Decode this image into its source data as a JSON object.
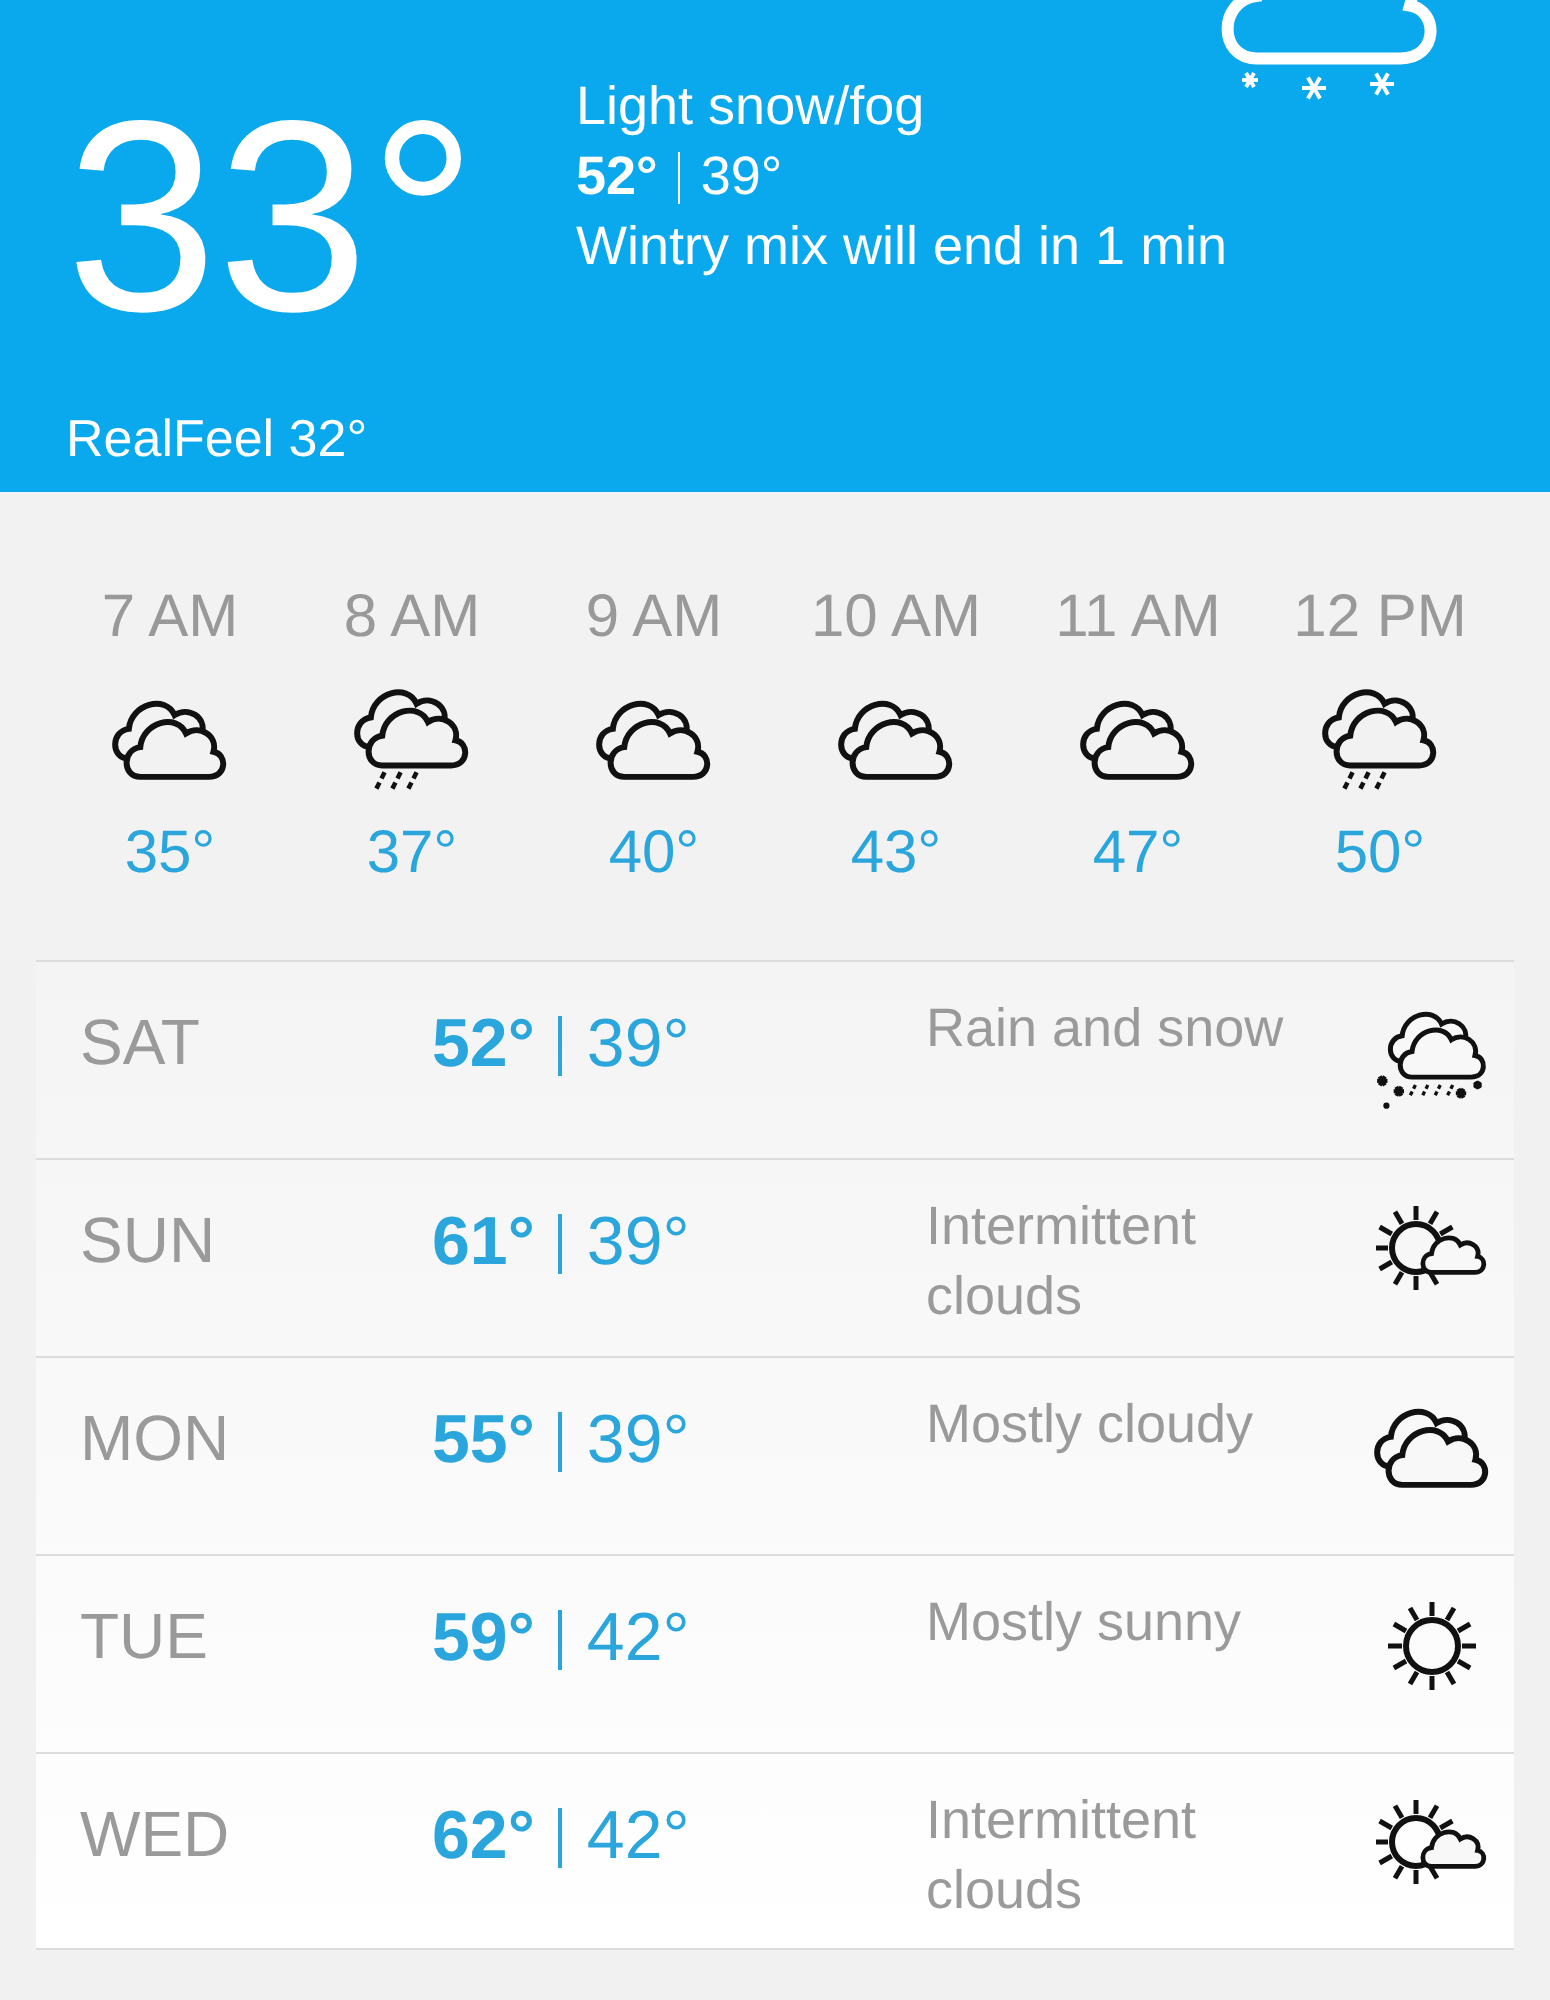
{
  "current": {
    "temperature": "33°",
    "condition": "Light snow/fog",
    "high": "52°",
    "low": "39°",
    "note": "Wintry mix will end in 1 min",
    "realfeel": "RealFeel 32°",
    "kind": "snow"
  },
  "hourly": [
    {
      "time": "7 AM",
      "kind": "cloudy",
      "temperature": "35°"
    },
    {
      "time": "8 AM",
      "kind": "rain",
      "temperature": "37°"
    },
    {
      "time": "9 AM",
      "kind": "cloudy",
      "temperature": "40°"
    },
    {
      "time": "10 AM",
      "kind": "cloudy",
      "temperature": "43°"
    },
    {
      "time": "11 AM",
      "kind": "cloudy",
      "temperature": "47°"
    },
    {
      "time": "12 PM",
      "kind": "rain",
      "temperature": "50°"
    }
  ],
  "daily": [
    {
      "day": "SAT",
      "high": "52°",
      "low": "39°",
      "description": "Rain and snow",
      "kind": "rain-snow"
    },
    {
      "day": "SUN",
      "high": "61°",
      "low": "39°",
      "description": "Intermittent clouds",
      "kind": "partly-sunny"
    },
    {
      "day": "MON",
      "high": "55°",
      "low": "39°",
      "description": "Mostly cloudy",
      "kind": "cloudy"
    },
    {
      "day": "TUE",
      "high": "59°",
      "low": "42°",
      "description": "Mostly sunny",
      "kind": "sunny"
    },
    {
      "day": "WED",
      "high": "62°",
      "low": "42°",
      "description": "Intermittent clouds",
      "kind": "partly-sunny"
    }
  ]
}
